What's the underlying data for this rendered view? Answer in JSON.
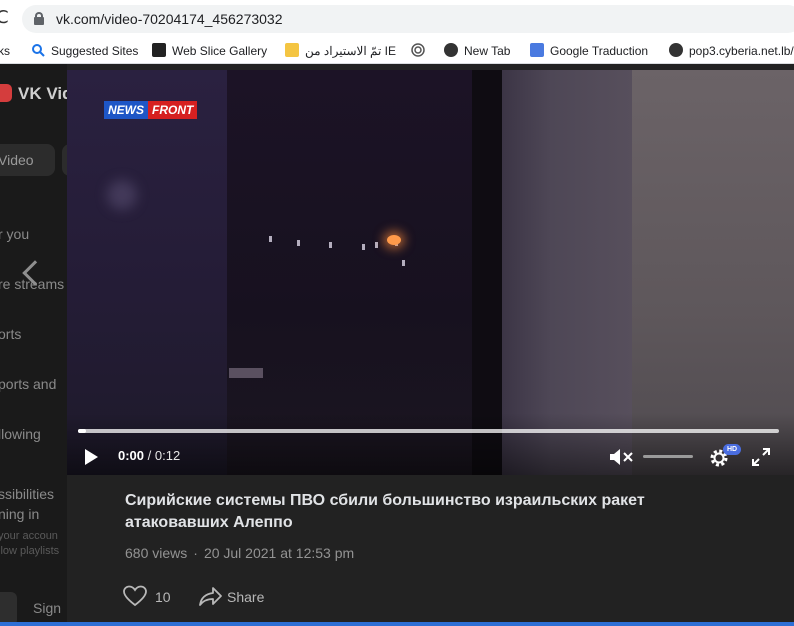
{
  "browser": {
    "url": "vk.com/video-70204174_456273032",
    "bookmarks": [
      {
        "label": "ks",
        "icon": "bookmark-folder-icon"
      },
      {
        "label": "Suggested Sites",
        "icon": "search-icon"
      },
      {
        "label": "Web Slice Gallery",
        "icon": "web-slice-icon"
      },
      {
        "label": "تمّ الاستيراد من IE",
        "icon": "folder-icon"
      },
      {
        "label": "",
        "icon": "circle-target-icon"
      },
      {
        "label": "New Tab",
        "icon": "globe-icon"
      },
      {
        "label": "Google Traduction",
        "icon": "translate-icon"
      },
      {
        "label": "pop3.cyberia.net.lb/",
        "icon": "globe-icon"
      }
    ]
  },
  "sidebar": {
    "title": "VK Vid",
    "video_tab": "Video",
    "items": [
      "r you",
      "re streams",
      "orts",
      "ports and",
      "llowing",
      "ssibilities",
      "ning in"
    ],
    "subtext": [
      "your accoun",
      "llow playlists",
      ""
    ],
    "sign_in": "Sign"
  },
  "player": {
    "watermark_part1": "NEWS",
    "watermark_part2": "FRONT",
    "current_time": "0:00",
    "separator": " / ",
    "duration": "0:12",
    "progress": 0.012,
    "hd_badge": "HD"
  },
  "video_info": {
    "title": "Сирийские системы ПВО сбили большинство израильских ракет атаковавших Алеппо",
    "views": "680 views",
    "dot": "·",
    "date": "20 Jul 2021 at 12:53 pm",
    "likes": "10",
    "share_label": "Share"
  },
  "colors": {
    "accent": "#2d6fd6",
    "brand_red": "#d62020",
    "brand_blue": "#1e56c6",
    "background": "#222222"
  }
}
